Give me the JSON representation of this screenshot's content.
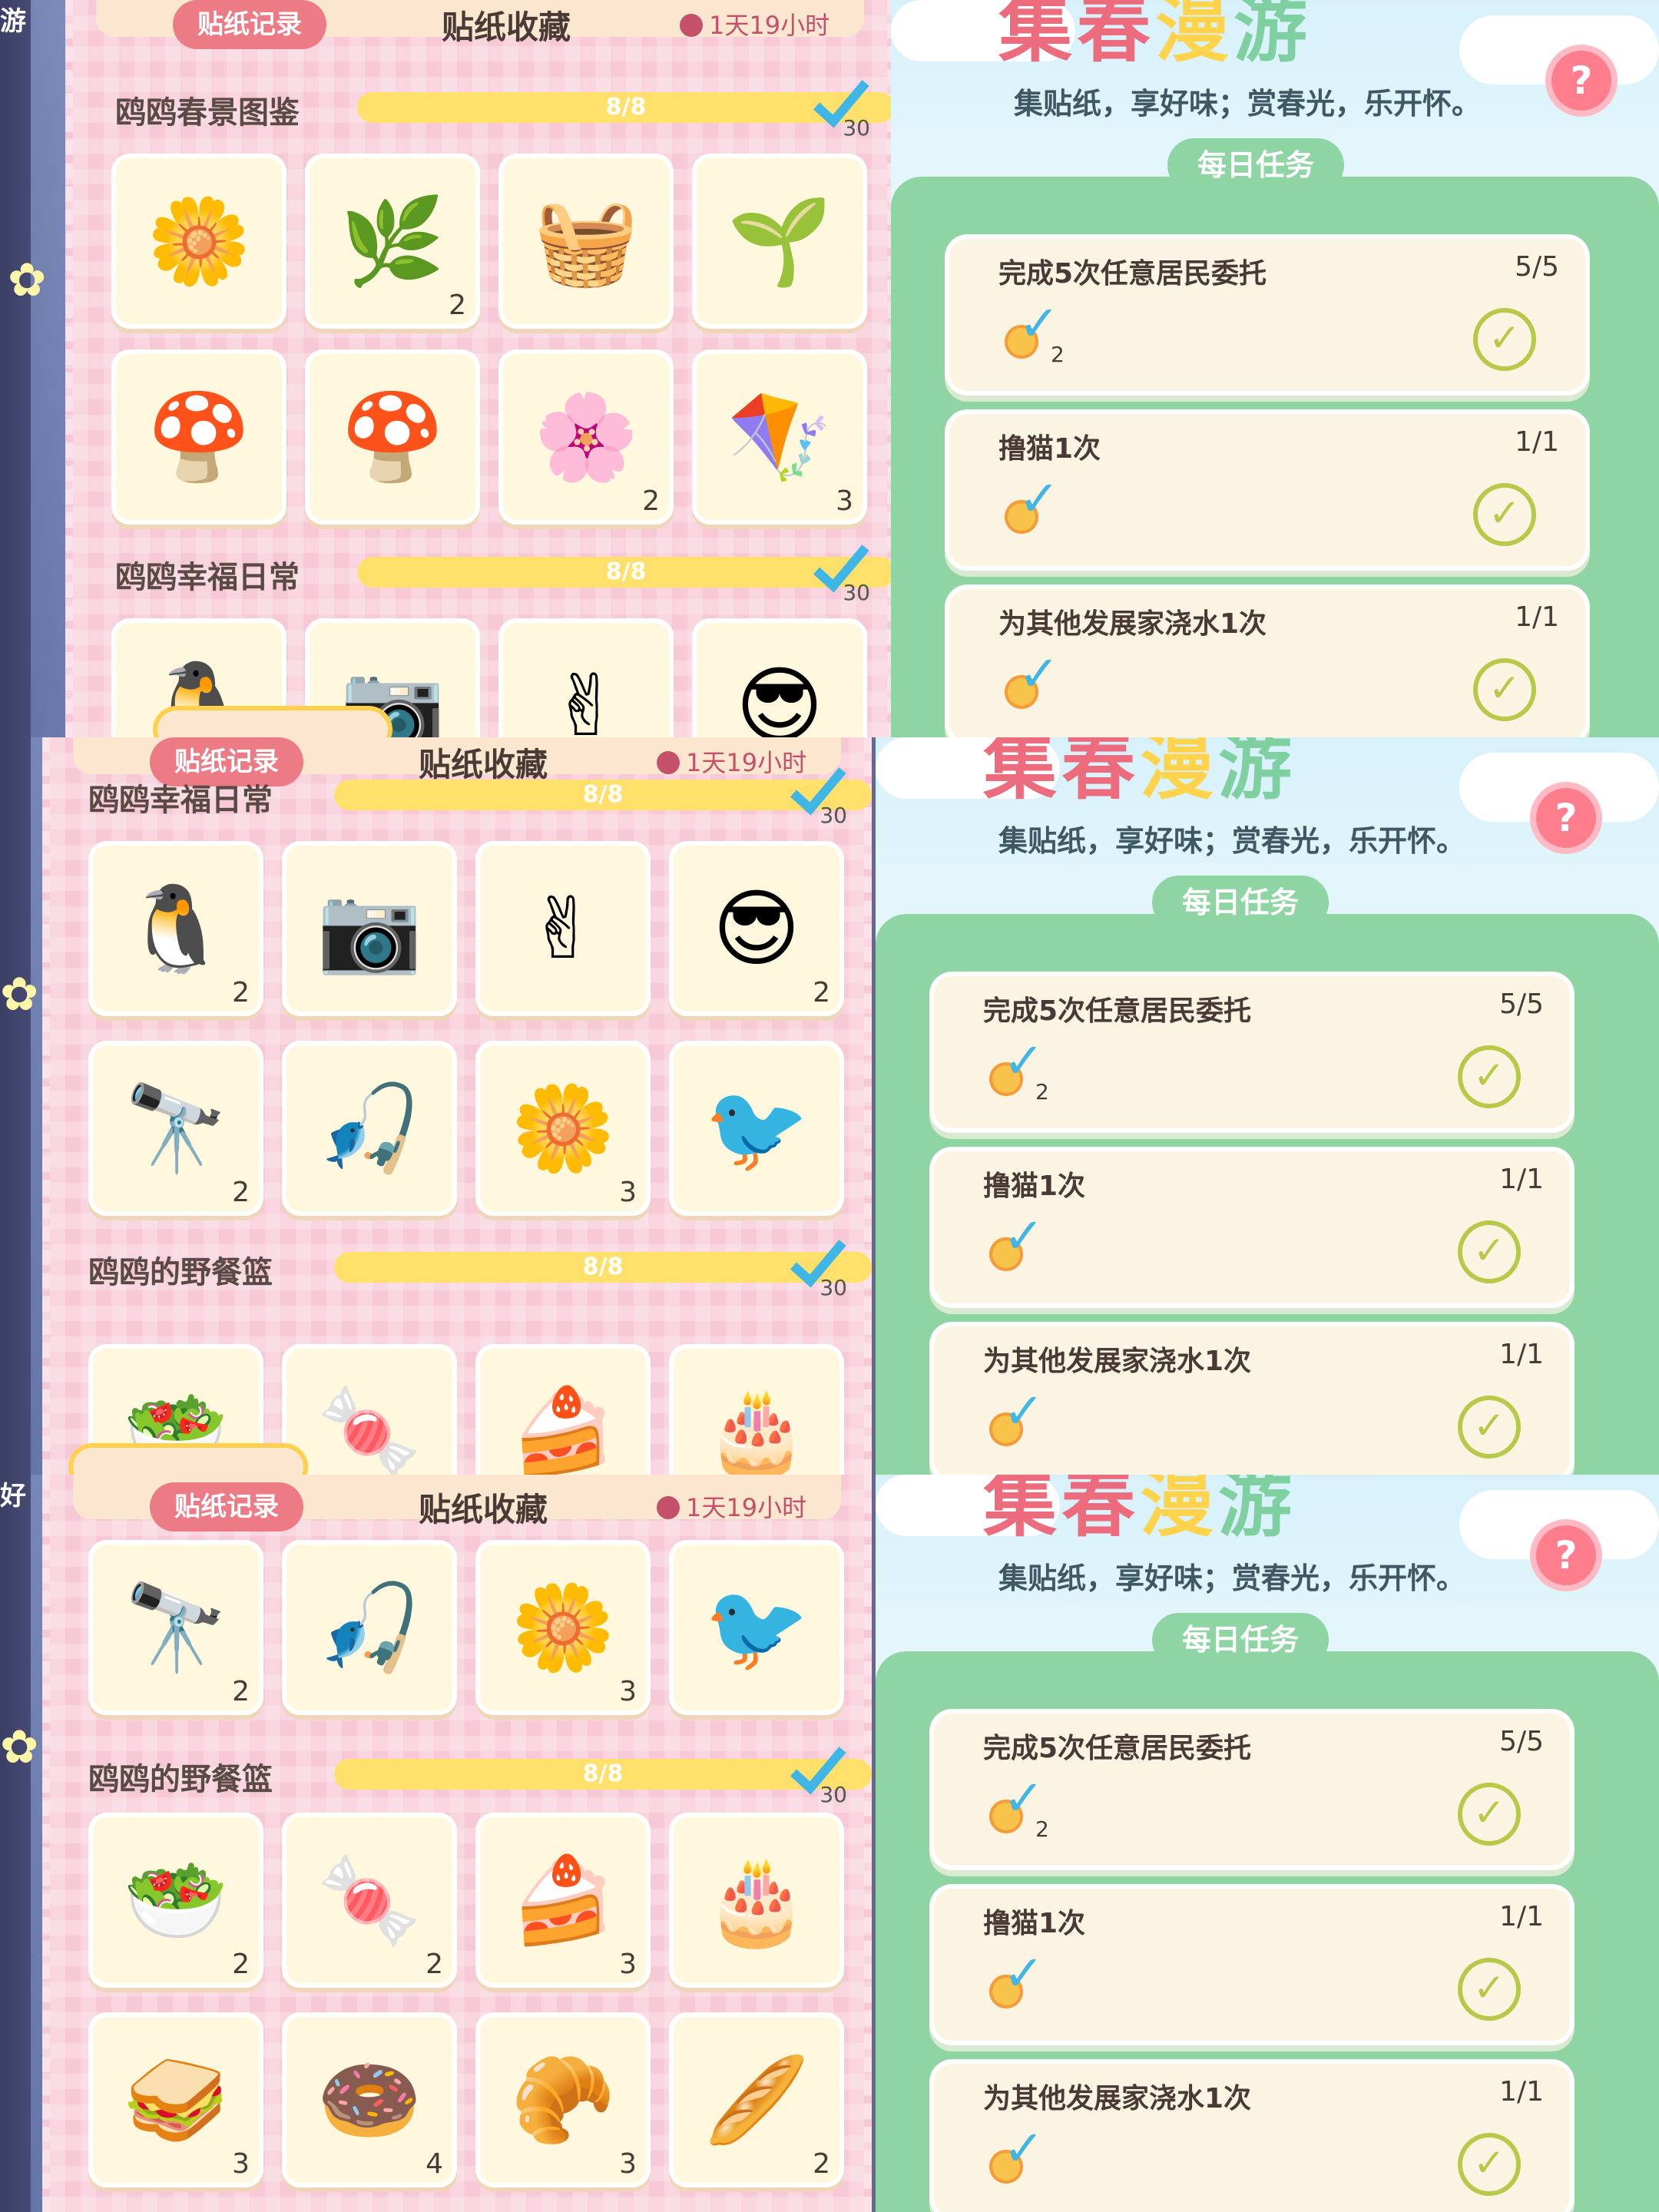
{
  "header": {
    "tab": "贴纸记录",
    "title": "贴纸收藏",
    "timer": "1天19小时"
  },
  "event": {
    "title_parts": [
      "集",
      "春",
      "漫",
      "游"
    ],
    "subtitle": "集贴纸，享好味；赏春光，乐开怀。",
    "help": "?",
    "daily_tab": "每日任务"
  },
  "sections": {
    "spring": {
      "title": "鸥鸥春景图鉴",
      "progress": "8/8",
      "progress_value": 1.0,
      "reward": "30"
    },
    "happy": {
      "title": "鸥鸥幸福日常",
      "progress": "8/8",
      "progress_value": 1.0,
      "reward": "30"
    },
    "picnic": {
      "title": "鸥鸥的野餐篮",
      "progress": "8/8",
      "progress_value": 1.0,
      "reward": "30"
    }
  },
  "stickers": {
    "spring": [
      {
        "icon": "dandelion-sticker-icon",
        "glyph": "🌼",
        "count": ""
      },
      {
        "icon": "willow-branch-sticker-icon",
        "glyph": "🌿",
        "count": "2"
      },
      {
        "icon": "picnic-basket-sticker-icon",
        "glyph": "🧺",
        "count": ""
      },
      {
        "icon": "sprout-sticker-icon",
        "glyph": "🌱",
        "count": ""
      },
      {
        "icon": "brown-mushroom-sticker-icon",
        "glyph": "🍄",
        "count": ""
      },
      {
        "icon": "red-mushroom-sticker-icon",
        "glyph": "🍄",
        "count": ""
      },
      {
        "icon": "white-flower-sticker-icon",
        "glyph": "🌸",
        "count": "2"
      },
      {
        "icon": "kite-sticker-icon",
        "glyph": "🪁",
        "count": "3"
      }
    ],
    "happy": [
      {
        "icon": "dancing-gull-sticker-icon",
        "glyph": "🐧",
        "count": "2"
      },
      {
        "icon": "camera-gull-sticker-icon",
        "glyph": "📷",
        "count": ""
      },
      {
        "icon": "peace-gull-sticker-icon",
        "glyph": "✌",
        "count": ""
      },
      {
        "icon": "sunglasses-gull-sticker-icon",
        "glyph": "😎",
        "count": "2"
      },
      {
        "icon": "binocular-gull-sticker-icon",
        "glyph": "🔭",
        "count": "2"
      },
      {
        "icon": "fishing-gull-sticker-icon",
        "glyph": "🎣",
        "count": ""
      },
      {
        "icon": "flower-gull-sticker-icon",
        "glyph": "🌼",
        "count": "3"
      },
      {
        "icon": "couple-gull-sticker-icon",
        "glyph": "🐦",
        "count": ""
      }
    ],
    "picnic": [
      {
        "icon": "salad-sticker-icon",
        "glyph": "🥗",
        "count": "2"
      },
      {
        "icon": "macaron-sticker-icon",
        "glyph": "🍬",
        "count": "2"
      },
      {
        "icon": "strawberry-cake-sticker-icon",
        "glyph": "🍰",
        "count": "3"
      },
      {
        "icon": "chocolate-cake-sticker-icon",
        "glyph": "🎂",
        "count": ""
      },
      {
        "icon": "sandwich-sticker-icon",
        "glyph": "🥪",
        "count": "3"
      },
      {
        "icon": "donut-sticker-icon",
        "glyph": "🍩",
        "count": "4"
      },
      {
        "icon": "croissant-sticker-icon",
        "glyph": "🥐",
        "count": "3"
      },
      {
        "icon": "bread-sticker-icon",
        "glyph": "🥖",
        "count": "2"
      }
    ]
  },
  "tasks": [
    {
      "text": "完成5次任意居民委托",
      "progress": "5/5",
      "reward_count": "2"
    },
    {
      "text": "撸猫1次",
      "progress": "1/1",
      "reward_count": ""
    },
    {
      "text": "为其他发展家浇水1次",
      "progress": "1/1",
      "reward_count": ""
    }
  ],
  "edge": {
    "label_top": "游",
    "label_mid": "好"
  },
  "colors": {
    "pink_panel": "#f7c9d6",
    "accent_red": "#ec7b86",
    "green": "#8fd4a3",
    "check_blue": "#3fb6e6",
    "check_olive": "#b8c94a"
  }
}
